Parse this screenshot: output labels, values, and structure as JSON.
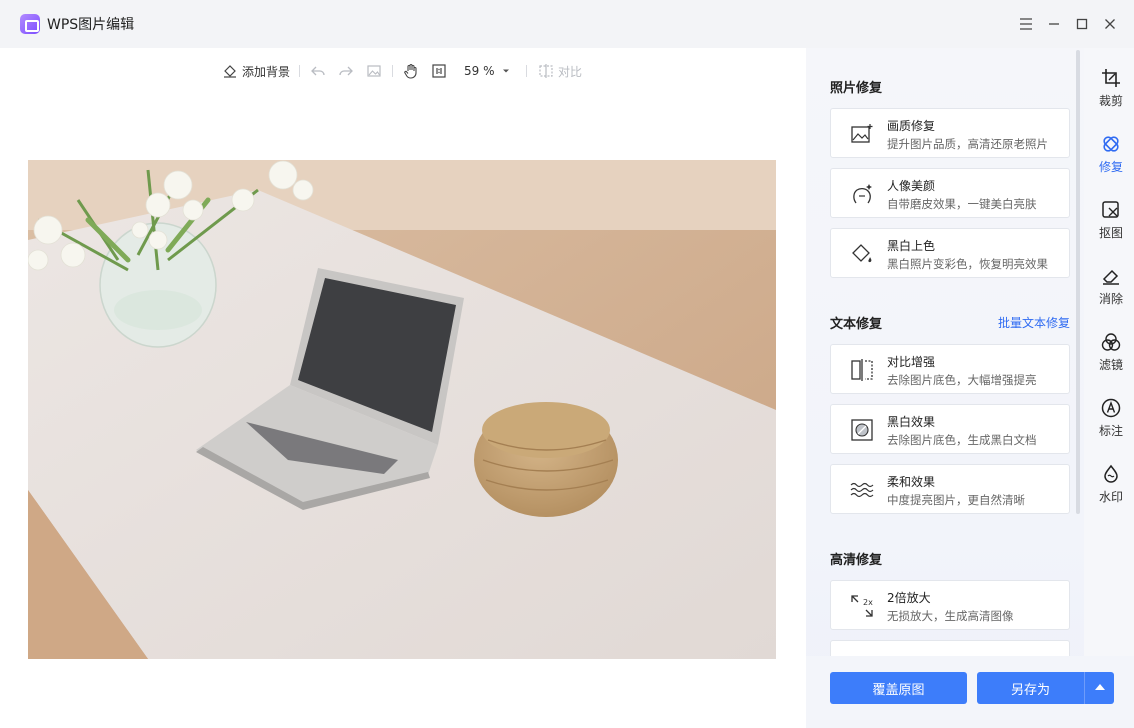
{
  "window": {
    "title": "WPS图片编辑",
    "menu_icon": "hamburger-icon",
    "minimize_icon": "minimize-icon",
    "maximize_icon": "maximize-icon",
    "close_icon": "close-icon"
  },
  "toolbar": {
    "add_background": "添加背景",
    "zoom": "59 %",
    "compare": "对比"
  },
  "panel": {
    "photo_repair": {
      "title": "照片修复",
      "items": [
        {
          "title": "画质修复",
          "desc": "提升图片品质，高清还原老照片",
          "icon": "image-enhance-icon"
        },
        {
          "title": "人像美颜",
          "desc": "自带磨皮效果，一键美白亮肤",
          "icon": "portrait-beauty-icon"
        },
        {
          "title": "黑白上色",
          "desc": "黑白照片变彩色，恢复明亮效果",
          "icon": "colorize-bucket-icon"
        }
      ]
    },
    "text_repair": {
      "title": "文本修复",
      "batch_link": "批量文本修复",
      "items": [
        {
          "title": "对比增强",
          "desc": "去除图片底色，大幅增强提亮",
          "icon": "contrast-enhance-icon"
        },
        {
          "title": "黑白效果",
          "desc": "去除图片底色，生成黑白文档",
          "icon": "black-white-icon"
        },
        {
          "title": "柔和效果",
          "desc": "中度提亮图片，更自然清晰",
          "icon": "soft-wave-icon"
        }
      ]
    },
    "hd_repair": {
      "title": "高清修复",
      "items": [
        {
          "title": "2倍放大",
          "desc": "无损放大，生成高清图像",
          "icon": "upscale-2x-icon"
        }
      ]
    }
  },
  "actions": {
    "overwrite": "覆盖原图",
    "save_as": "另存为"
  },
  "rail": {
    "items": [
      {
        "label": "裁剪",
        "icon": "crop-icon",
        "active": false
      },
      {
        "label": "修复",
        "icon": "repair-bandage-icon",
        "active": true
      },
      {
        "label": "抠图",
        "icon": "cutout-icon",
        "active": false
      },
      {
        "label": "消除",
        "icon": "eraser-icon",
        "active": false
      },
      {
        "label": "滤镜",
        "icon": "filter-circles-icon",
        "active": false
      },
      {
        "label": "标注",
        "icon": "annotate-icon",
        "active": false
      },
      {
        "label": "水印",
        "icon": "watermark-drop-icon",
        "active": false
      }
    ]
  },
  "colors": {
    "accent": "#3d7dfa",
    "link": "#2f6bf2"
  }
}
